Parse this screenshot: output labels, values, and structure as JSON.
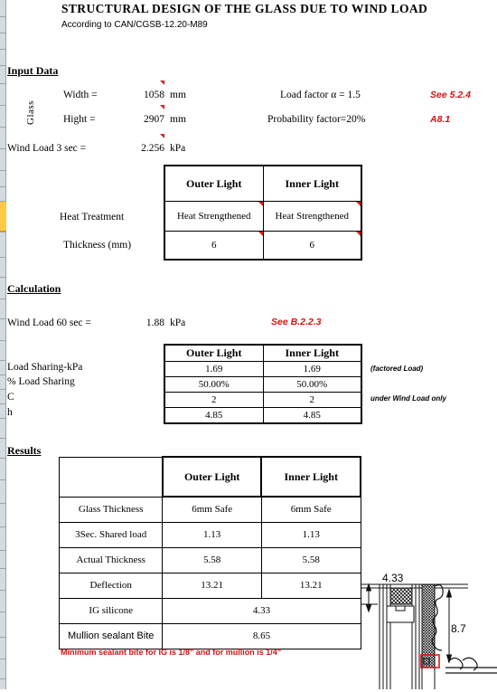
{
  "header": {
    "title": "STRUCTURAL DESIGN OF THE GLASS DUE TO WIND LOAD",
    "subtitle": "According to CAN/CGSB-12.20-M89"
  },
  "sections": {
    "input": "Input Data",
    "calculation": "Calculation",
    "results": "Results"
  },
  "input": {
    "group_label": "Glass",
    "width_label": "Width  =",
    "width_value": "1058",
    "width_unit": "mm",
    "height_label": "Hight  =",
    "height_value": "2907",
    "height_unit": "mm",
    "wind_label": "Wind Load 3 sec =",
    "wind_value": "2.256",
    "wind_unit": "kPa",
    "load_factor_label": "Load factor  α = 1.5",
    "load_factor_ref": "See 5.2.4",
    "probability_label": "Probability factor=20%",
    "probability_ref": "A8.1",
    "heat_label": "Heat Treatment",
    "thickness_label": "Thickness (mm)",
    "columns": [
      "Outer Light",
      "Inner Light"
    ],
    "heat_values": [
      "Heat Strengthened",
      "Heat Strengthened"
    ],
    "thickness_values": [
      "6",
      "6"
    ]
  },
  "calculation": {
    "wind_label": "Wind Load 60 sec =",
    "wind_value": "1.88",
    "wind_unit": "kPa",
    "wind_ref": "See B.2.2.3",
    "columns": [
      "Outer Light",
      "Inner Light"
    ],
    "rows": [
      {
        "label": "Load Sharing-kPa",
        "values": [
          "1.69",
          "1.69"
        ],
        "note": "(factored Load)"
      },
      {
        "label": "% Load Sharing",
        "values": [
          "50.00%",
          "50.00%"
        ],
        "note": ""
      },
      {
        "label": "C",
        "values": [
          "2",
          "2"
        ],
        "note": "under Wind Load only"
      },
      {
        "label": "h",
        "values": [
          "4.85",
          "4.85"
        ],
        "note": ""
      }
    ]
  },
  "results": {
    "columns": [
      "Outer Light",
      "Inner Light"
    ],
    "rows": [
      {
        "label": "Glass Thickness",
        "values": [
          "6mm Safe",
          "6mm Safe"
        ],
        "merged": false
      },
      {
        "label": "3Sec. Shared load",
        "values": [
          "1.13",
          "1.13"
        ],
        "merged": false
      },
      {
        "label": "Actual Thickness",
        "values": [
          "5.58",
          "5.58"
        ],
        "merged": false
      },
      {
        "label": "Deflection",
        "values": [
          "13.21",
          "13.21"
        ],
        "merged": false
      },
      {
        "label": "IG silicone",
        "values": [
          "4.33"
        ],
        "merged": true
      },
      {
        "label": "Mullion sealant Bite",
        "values": [
          "8.65"
        ],
        "merged": true
      }
    ],
    "footnote": "Minimum sealant bite for IG is 1/8\" and for mullion is 1/4\""
  },
  "drawing": {
    "dim_top": "4.33",
    "dim_right": "8.7"
  },
  "colors": {
    "outer_light_fill": "#FBE4D5",
    "inner_light_fill": "#DAEEF3",
    "red_note": "#D81010",
    "gutter_highlight": "#FFC943"
  }
}
